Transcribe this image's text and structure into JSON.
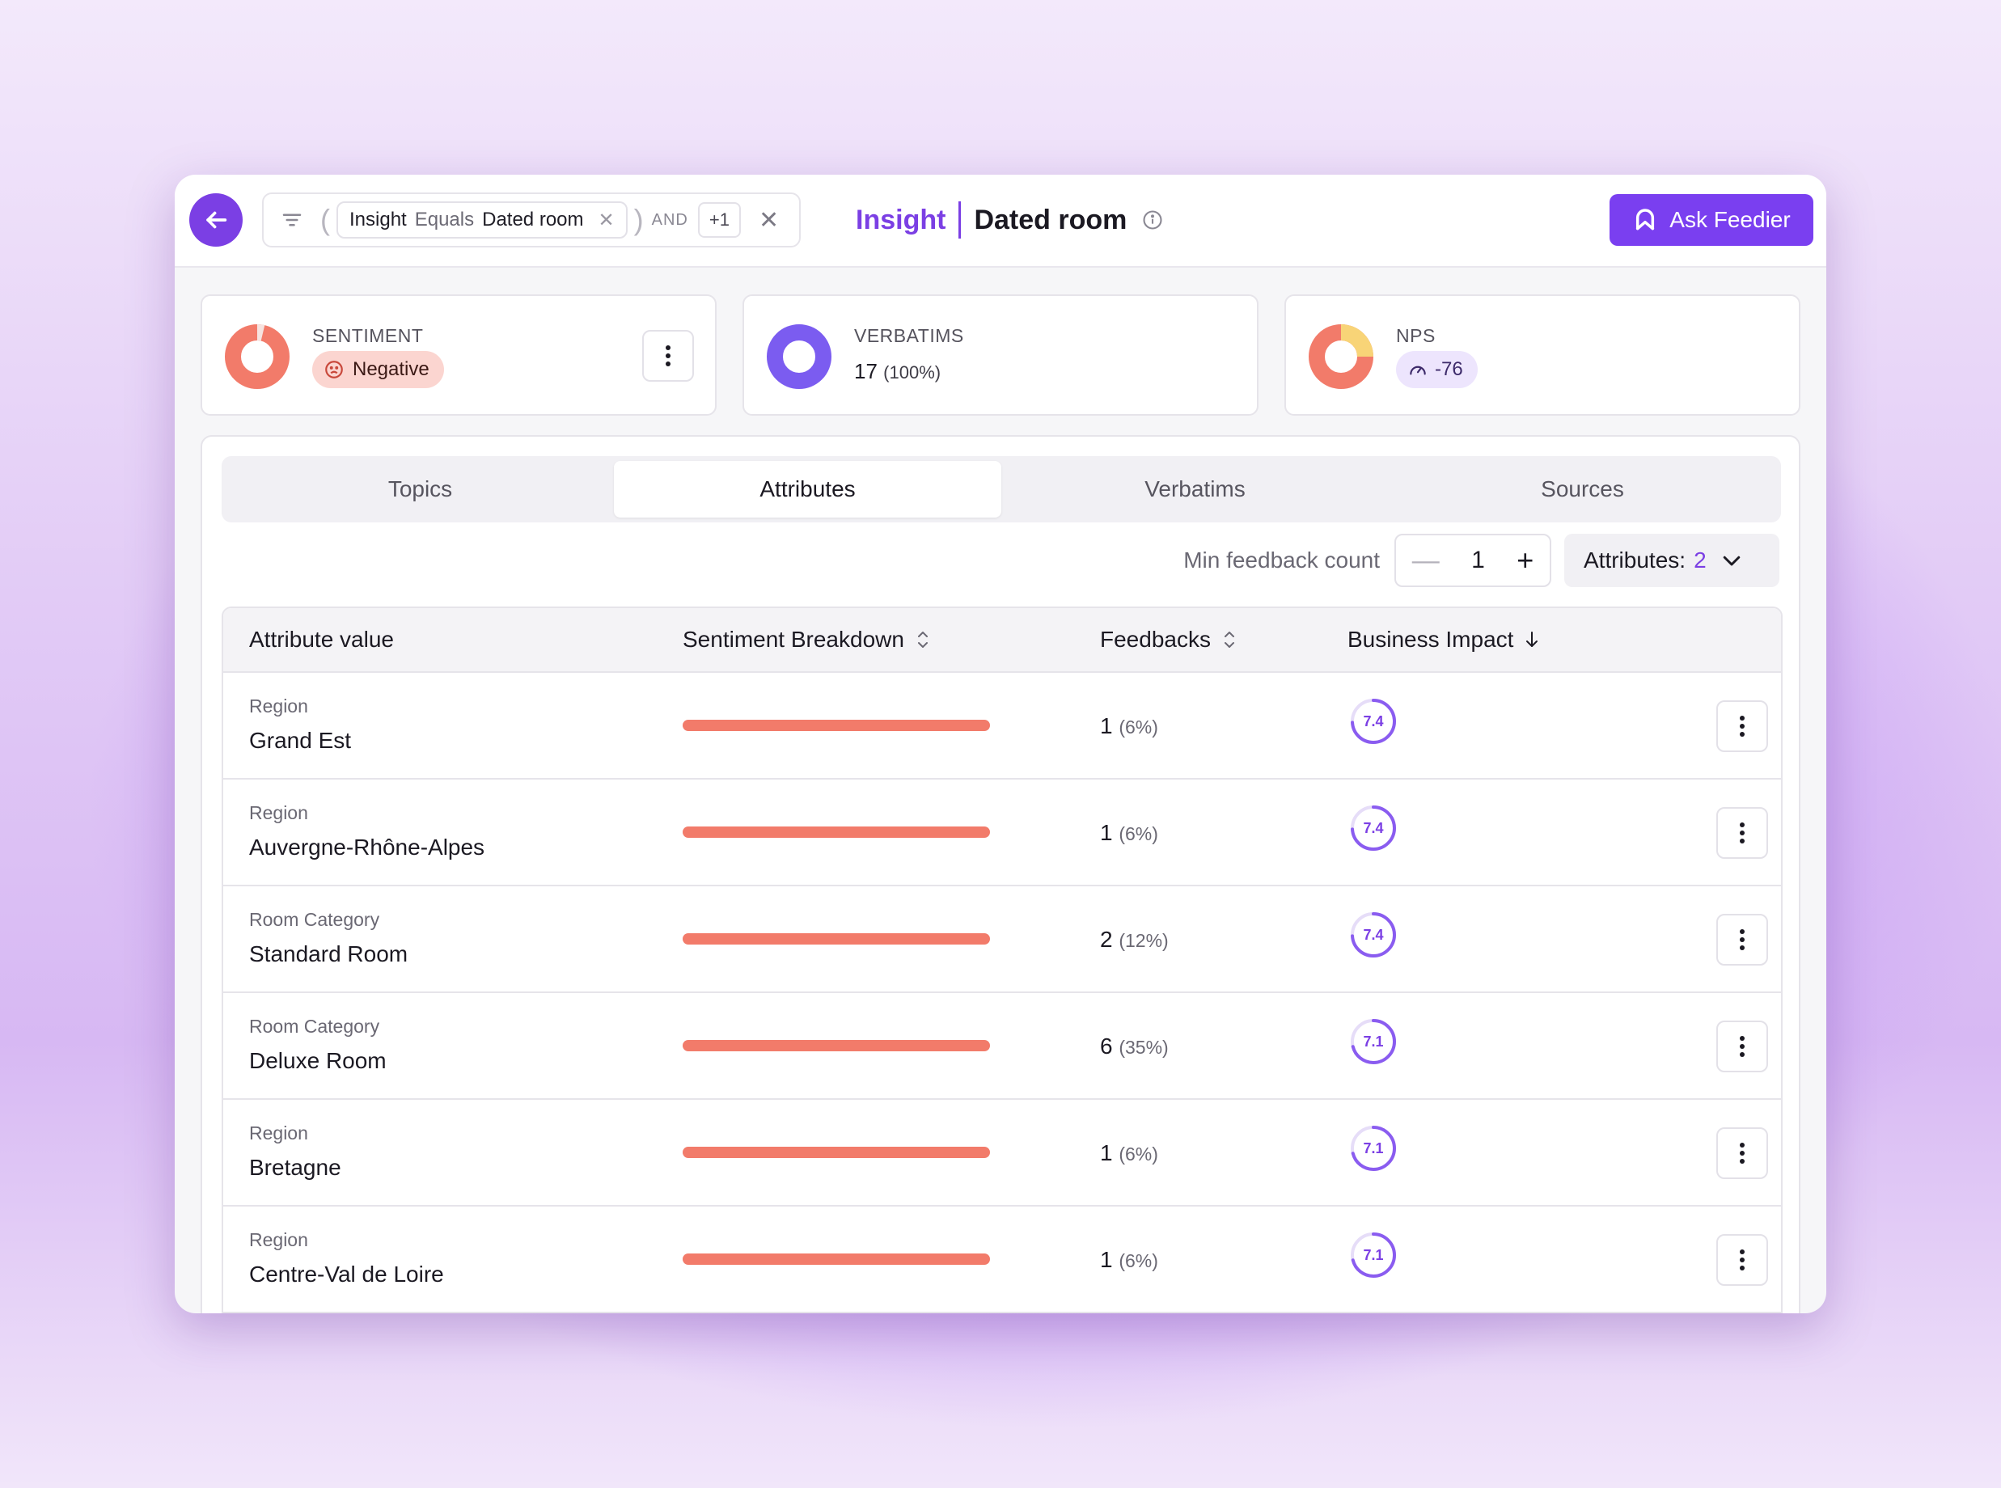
{
  "filter": {
    "field": "Insight",
    "operator": "Equals",
    "value": "Dated room",
    "conjunction": "AND",
    "extra": "+1"
  },
  "breadcrumb": {
    "section": "Insight",
    "title": "Dated room"
  },
  "ask_button": "Ask Feedier",
  "cards": {
    "sentiment": {
      "label": "SENTIMENT",
      "value": "Negative"
    },
    "verbatims": {
      "label": "VERBATIMS",
      "count": "17",
      "pct": "(100%)"
    },
    "nps": {
      "label": "NPS",
      "value": "-76"
    }
  },
  "tabs": [
    "Topics",
    "Attributes",
    "Verbatims",
    "Sources"
  ],
  "active_tab": "Attributes",
  "controls": {
    "min_label": "Min feedback count",
    "minus": "—",
    "min_value": "1",
    "plus": "+",
    "attributes_label": "Attributes:",
    "attributes_count": "2"
  },
  "table": {
    "headers": [
      "Attribute value",
      "Sentiment Breakdown",
      "Feedbacks",
      "Business Impact"
    ],
    "rows": [
      {
        "type": "Region",
        "value": "Grand Est",
        "count": "1",
        "pct": "(6%)",
        "impact": "7.4",
        "impact_fraction": 0.74
      },
      {
        "type": "Region",
        "value": "Auvergne-Rhône-Alpes",
        "count": "1",
        "pct": "(6%)",
        "impact": "7.4",
        "impact_fraction": 0.74
      },
      {
        "type": "Room Category",
        "value": "Standard Room",
        "count": "2",
        "pct": "(12%)",
        "impact": "7.4",
        "impact_fraction": 0.74
      },
      {
        "type": "Room Category",
        "value": "Deluxe Room",
        "count": "6",
        "pct": "(35%)",
        "impact": "7.1",
        "impact_fraction": 0.71
      },
      {
        "type": "Region",
        "value": "Bretagne",
        "count": "1",
        "pct": "(6%)",
        "impact": "7.1",
        "impact_fraction": 0.71
      },
      {
        "type": "Region",
        "value": "Centre-Val de Loire",
        "count": "1",
        "pct": "(6%)",
        "impact": "7.1",
        "impact_fraction": 0.71
      }
    ]
  },
  "colors": {
    "accent": "#7b3fe4",
    "negative": "#f27b6a",
    "negative_bg": "#fbd5d0",
    "nps_yellow": "#f8d477"
  },
  "icons": [
    "arrow-left-icon",
    "filter-icon",
    "close-icon",
    "info-icon",
    "feedier-logo-icon",
    "frown-icon",
    "gauge-icon",
    "kebab-icon",
    "sort-icon",
    "arrow-down-icon",
    "chevron-down-icon"
  ]
}
